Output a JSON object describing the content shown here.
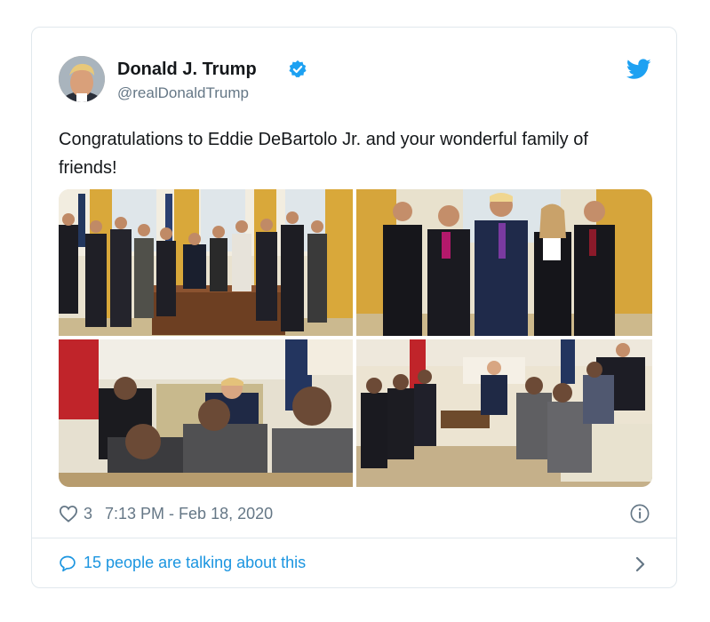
{
  "tweet": {
    "display_name": "Donald J. Trump",
    "handle": "@realDonaldTrump",
    "verified": true,
    "text": "Congratulations to Eddie DeBartolo Jr. and your wonderful family of friends!",
    "likes": "3",
    "timestamp": "7:13 PM - Feb 18, 2020",
    "talking": "15 people are talking about this"
  },
  "icons": {
    "verified": "verified-badge-icon",
    "brand": "twitter-bird-icon",
    "like": "heart-icon",
    "info": "info-icon",
    "reply": "speech-bubble-icon",
    "more": "chevron-right-icon"
  },
  "colors": {
    "brand": "#1da1f2",
    "link": "#1b95e0",
    "muted": "#657786",
    "text": "#14171a",
    "border": "#e1e8ed"
  },
  "media": {
    "photo_count": 4
  }
}
